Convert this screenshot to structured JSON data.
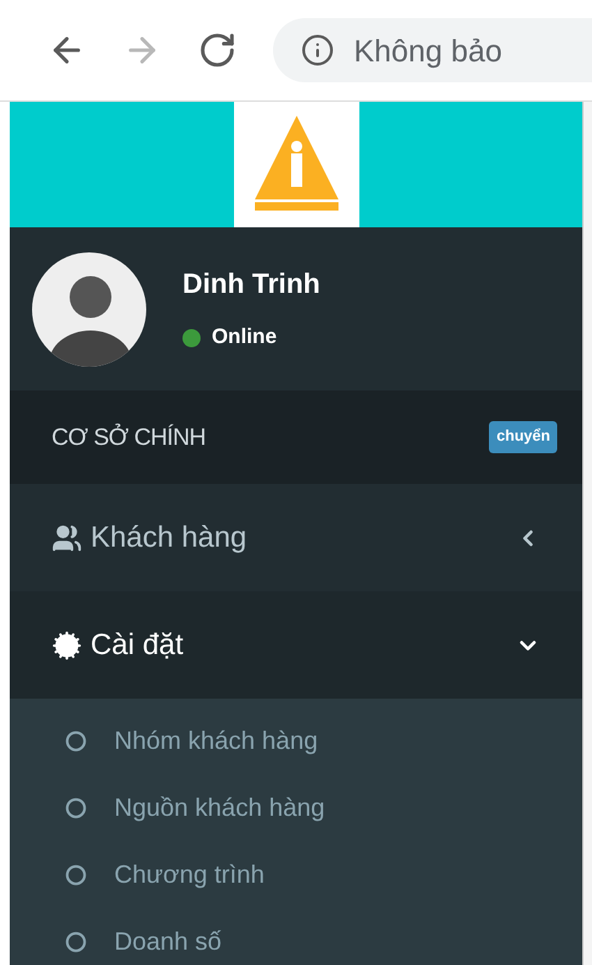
{
  "browser": {
    "nav_buttons": [
      {
        "kind": "back",
        "disabled": false
      },
      {
        "kind": "forward",
        "disabled": true
      },
      {
        "kind": "reload",
        "disabled": false
      }
    ],
    "address": "Không bảo"
  },
  "user": {
    "name": "Dinh Trinh",
    "status": "Online"
  },
  "branch": {
    "label": "CƠ SỞ CHÍNH",
    "badge": "chuyển"
  },
  "menu": [
    {
      "label": "Khách hàng",
      "expanded": false
    },
    {
      "label": "Cài đặt",
      "expanded": true,
      "children": [
        {
          "label": "Nhóm khách hàng"
        },
        {
          "label": "Nguồn khách hàng"
        },
        {
          "label": "Chương trình"
        },
        {
          "label": "Doanh số"
        }
      ]
    }
  ]
}
